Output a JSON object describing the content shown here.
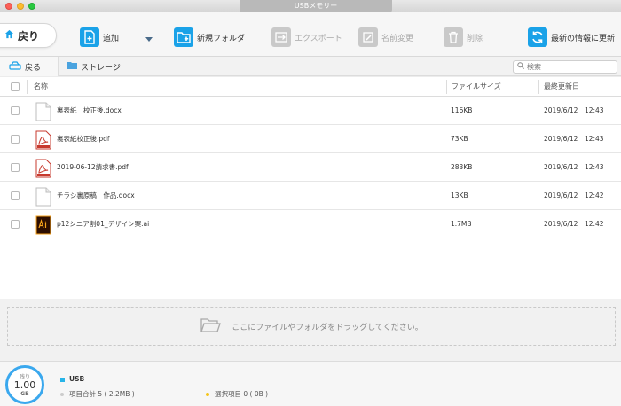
{
  "window": {
    "title": "USBメモリー"
  },
  "toolbar": {
    "back_label": "戻り",
    "add_label": "追加",
    "new_folder_label": "新規フォルダ",
    "export_label": "エクスポート",
    "rename_label": "名前変更",
    "delete_label": "削除",
    "refresh_label": "最新の情報に更新"
  },
  "nav": {
    "back_label": "戻る",
    "breadcrumb": "ストレージ",
    "search_placeholder": "検索"
  },
  "table": {
    "headers": {
      "name": "名称",
      "size": "ファイルサイズ",
      "modified": "最終更新日"
    },
    "rows": [
      {
        "name": "裏表紙　校正後.docx",
        "size": "116KB",
        "modified": "2019/6/12　12:43",
        "icon": "doc-file-icon"
      },
      {
        "name": "裏表紙校正後.pdf",
        "size": "73KB",
        "modified": "2019/6/12　12:43",
        "icon": "pdf-file-icon"
      },
      {
        "name": "2019-06-12請求書.pdf",
        "size": "283KB",
        "modified": "2019/6/12　12:43",
        "icon": "pdf-file-icon"
      },
      {
        "name": "チラシ裏原稿　作品.docx",
        "size": "13KB",
        "modified": "2019/6/12　12:42",
        "icon": "doc-file-icon"
      },
      {
        "name": "p12シニア割01_デザイン案.ai",
        "size": "1.7MB",
        "modified": "2019/6/12　12:42",
        "icon": "ai-file-icon"
      }
    ]
  },
  "dropzone": {
    "text": "ここにファイルやフォルダをドラッグしてください。"
  },
  "footer": {
    "gauge_top": "残り",
    "gauge_value": "1.00",
    "gauge_unit": "GB",
    "device_name": "USB",
    "total_items": "項目合計 5 ( 2.2MB )",
    "selected_items": "選択項目 0 ( 0B )",
    "device_color": "#27b4e8",
    "total_dot_color": "#cccccc",
    "selected_dot_color": "#f5c518"
  },
  "colors": {
    "accent": "#1aa2e8",
    "disabled": "#c9c9c9"
  }
}
